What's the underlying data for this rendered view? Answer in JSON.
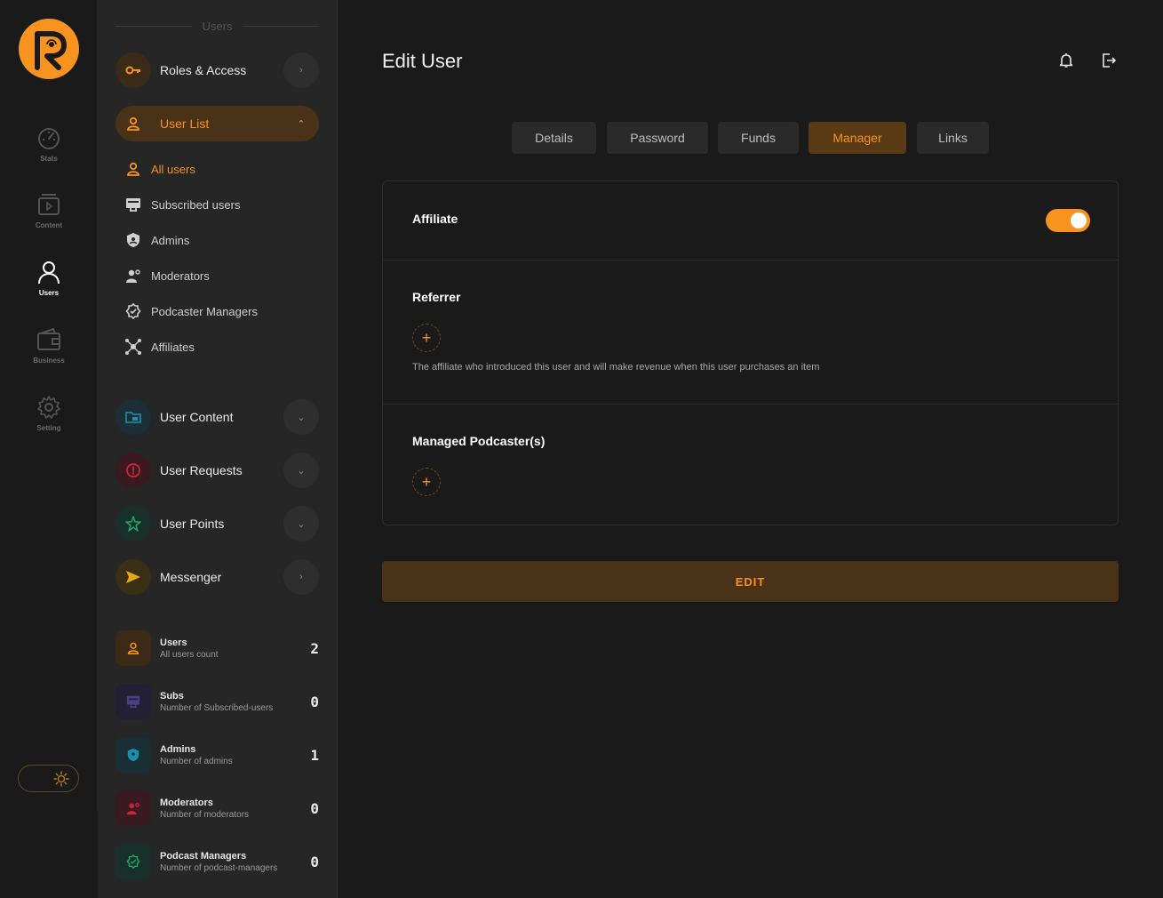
{
  "rail": {
    "items": [
      {
        "label": "Stats",
        "icon": "gauge-icon"
      },
      {
        "label": "Content",
        "icon": "media-icon"
      },
      {
        "label": "Users",
        "icon": "user-icon"
      },
      {
        "label": "Business",
        "icon": "wallet-icon"
      },
      {
        "label": "Setting",
        "icon": "gear-icon"
      }
    ]
  },
  "menu": {
    "section_title": "Users",
    "roles": {
      "label": "Roles & Access"
    },
    "user_list": {
      "label": "User List"
    },
    "sub_items": [
      {
        "label": "All users"
      },
      {
        "label": "Subscribed users"
      },
      {
        "label": "Admins"
      },
      {
        "label": "Moderators"
      },
      {
        "label": "Podcaster Managers"
      },
      {
        "label": "Affiliates"
      }
    ],
    "groups": [
      {
        "label": "User Content"
      },
      {
        "label": "User Requests"
      },
      {
        "label": "User Points"
      },
      {
        "label": "Messenger"
      }
    ]
  },
  "stats": [
    {
      "title": "Users",
      "subtitle": "All users count",
      "value": "2"
    },
    {
      "title": "Subs",
      "subtitle": "Number of Subscribed-users",
      "value": "0"
    },
    {
      "title": "Admins",
      "subtitle": "Number of admins",
      "value": "1"
    },
    {
      "title": "Moderators",
      "subtitle": "Number of moderators",
      "value": "0"
    },
    {
      "title": "Podcast Managers",
      "subtitle": "Number of podcast-managers",
      "value": "0"
    }
  ],
  "main": {
    "title": "Edit User",
    "tabs": [
      {
        "label": "Details"
      },
      {
        "label": "Password"
      },
      {
        "label": "Funds"
      },
      {
        "label": "Manager"
      },
      {
        "label": "Links"
      }
    ],
    "active_tab": "Manager",
    "affiliate": {
      "label": "Affiliate",
      "enabled": true
    },
    "referrer": {
      "label": "Referrer",
      "help": "The affiliate who introduced this user and will make revenue when this user purchases an item"
    },
    "managed": {
      "label": "Managed Podcaster(s)"
    },
    "edit_label": "EDIT"
  },
  "colors": {
    "accent": "#f7931e",
    "background": "#1a1a1a",
    "panel": "#262626"
  }
}
